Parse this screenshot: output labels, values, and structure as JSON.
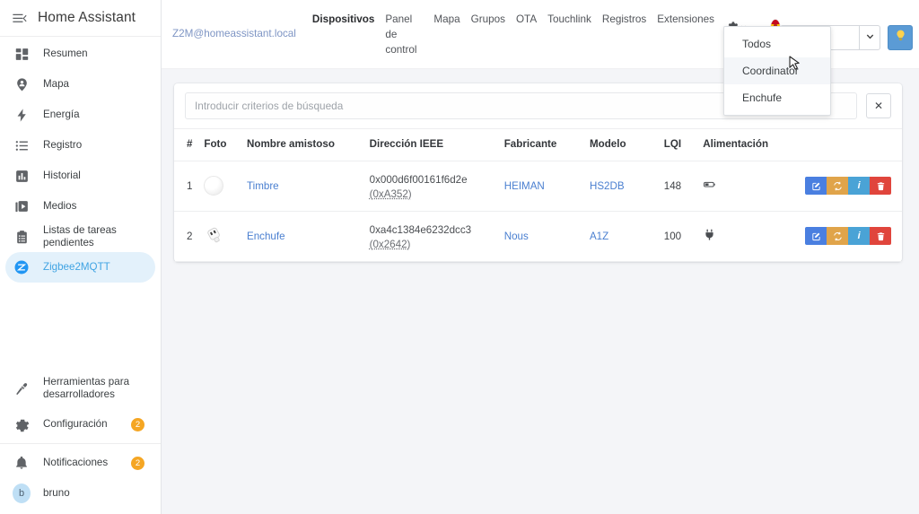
{
  "sidebar": {
    "title": "Home Assistant",
    "burger_icon": "menu-collapse-icon",
    "items": [
      {
        "label": "Resumen",
        "icon": "dashboard-icon"
      },
      {
        "label": "Mapa",
        "icon": "map-marker-account-icon"
      },
      {
        "label": "Energía",
        "icon": "lightning-bolt-icon"
      },
      {
        "label": "Registro",
        "icon": "format-list-bulleted-icon"
      },
      {
        "label": "Historial",
        "icon": "chart-box-icon"
      },
      {
        "label": "Medios",
        "icon": "play-box-multiple-icon"
      },
      {
        "label": "Listas de tareas pendientes",
        "icon": "clipboard-list-icon"
      },
      {
        "label": "Zigbee2MQTT",
        "icon": "zigbee2mqtt-icon",
        "active": true
      }
    ],
    "tools": [
      {
        "label": "Herramientas para desarrolladores",
        "icon": "hammer-icon"
      },
      {
        "label": "Configuración",
        "icon": "gear-icon",
        "badge": "2"
      }
    ],
    "bottom": [
      {
        "label": "Notificaciones",
        "icon": "bell-icon",
        "badge": "2"
      },
      {
        "label": "bruno",
        "icon": "avatar",
        "avatar_letter": "b"
      }
    ]
  },
  "topbar": {
    "brand": "Z2M@homeassistant.local",
    "tabs": [
      {
        "label": "Dispositivos",
        "active": true,
        "wide": true
      },
      {
        "label": "Panel de control",
        "active": false,
        "wide": false
      },
      {
        "label": "Mapa",
        "active": false,
        "wide": true
      },
      {
        "label": "Grupos",
        "active": false,
        "wide": true
      },
      {
        "label": "OTA",
        "active": false,
        "wide": true
      },
      {
        "label": "Touchlink",
        "active": false,
        "wide": true
      },
      {
        "label": "Registros",
        "active": false,
        "wide": true
      },
      {
        "label": "Extensiones",
        "active": false,
        "wide": true
      }
    ],
    "settings_icon": "gear-icon",
    "settings_caret_icon": "chevron-down-icon",
    "language_flag": "spain-flag-icon",
    "filter_select_value": "(Todos)",
    "filter_caret_icon": "chevron-down-icon",
    "theme_button_icon": "lightbulb-icon"
  },
  "dropdown": {
    "items": [
      {
        "label": "Todos",
        "hovered": false
      },
      {
        "label": "Coordinator",
        "hovered": true
      },
      {
        "label": "Enchufe",
        "hovered": false
      }
    ]
  },
  "search": {
    "placeholder": "Introducir criterios de búsqueda",
    "value": "",
    "clear_label": "✕"
  },
  "table": {
    "columns": [
      "#",
      "Foto",
      "Nombre amistoso",
      "Dirección IEEE",
      "Fabricante",
      "Modelo",
      "LQI",
      "Alimentación",
      ""
    ],
    "rows": [
      {
        "num": "1",
        "photo": "doorbell-thumbnail",
        "name": "Timbre",
        "ieee": "0x000d6f00161f6d2e",
        "short_addr": "(0xA352)",
        "manufacturer": "HEIMAN",
        "model": "HS2DB",
        "lqi": "148",
        "power": "battery-icon",
        "actions": [
          "edit-icon",
          "reload-icon",
          "info-icon",
          "delete-icon"
        ]
      },
      {
        "num": "2",
        "photo": "plug-thumbnail",
        "name": "Enchufe",
        "ieee": "0xa4c1384e6232dcc3",
        "short_addr": "(0x2642)",
        "manufacturer": "Nous",
        "model": "A1Z",
        "lqi": "100",
        "power": "power-plug-icon",
        "actions": [
          "edit-icon",
          "reload-icon",
          "info-icon",
          "delete-icon"
        ]
      }
    ]
  },
  "colors": {
    "accent_blue": "#41a4e3",
    "link_blue": "#4a7fd0",
    "badge_orange": "#f5a623",
    "content_bg": "#f4f5f8",
    "action_edit": "#4a7fe0",
    "action_reload": "#e0a44a",
    "action_info": "#4aa3d6",
    "action_delete": "#e0453c"
  }
}
